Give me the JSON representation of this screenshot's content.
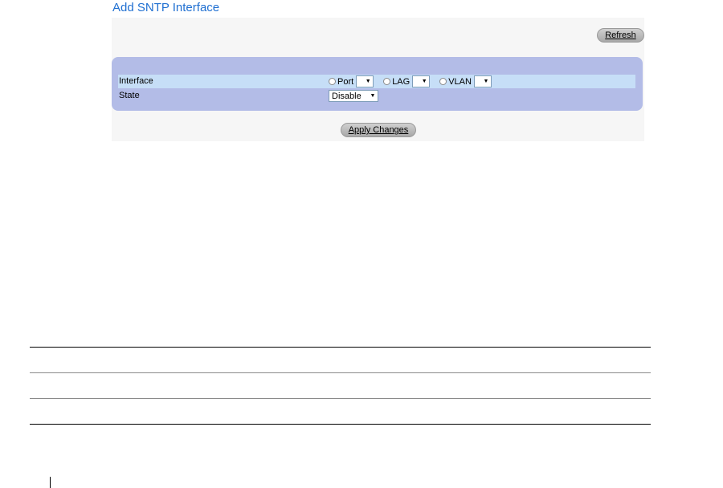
{
  "page": {
    "title": "Add SNTP Interface",
    "refresh_label": "Refresh",
    "apply_label": "Apply Changes"
  },
  "form": {
    "interface": {
      "label": "Interface",
      "options": [
        {
          "label": "Port",
          "selected": false,
          "value": ""
        },
        {
          "label": "LAG",
          "selected": false,
          "value": ""
        },
        {
          "label": "VLAN",
          "selected": false,
          "value": ""
        }
      ]
    },
    "state": {
      "label": "State",
      "value": "Disable"
    }
  },
  "colors": {
    "title": "#1f6fd1",
    "form_box": "#b3bce7",
    "interface_row": "#c6def7",
    "button": "#b8b8b8"
  }
}
